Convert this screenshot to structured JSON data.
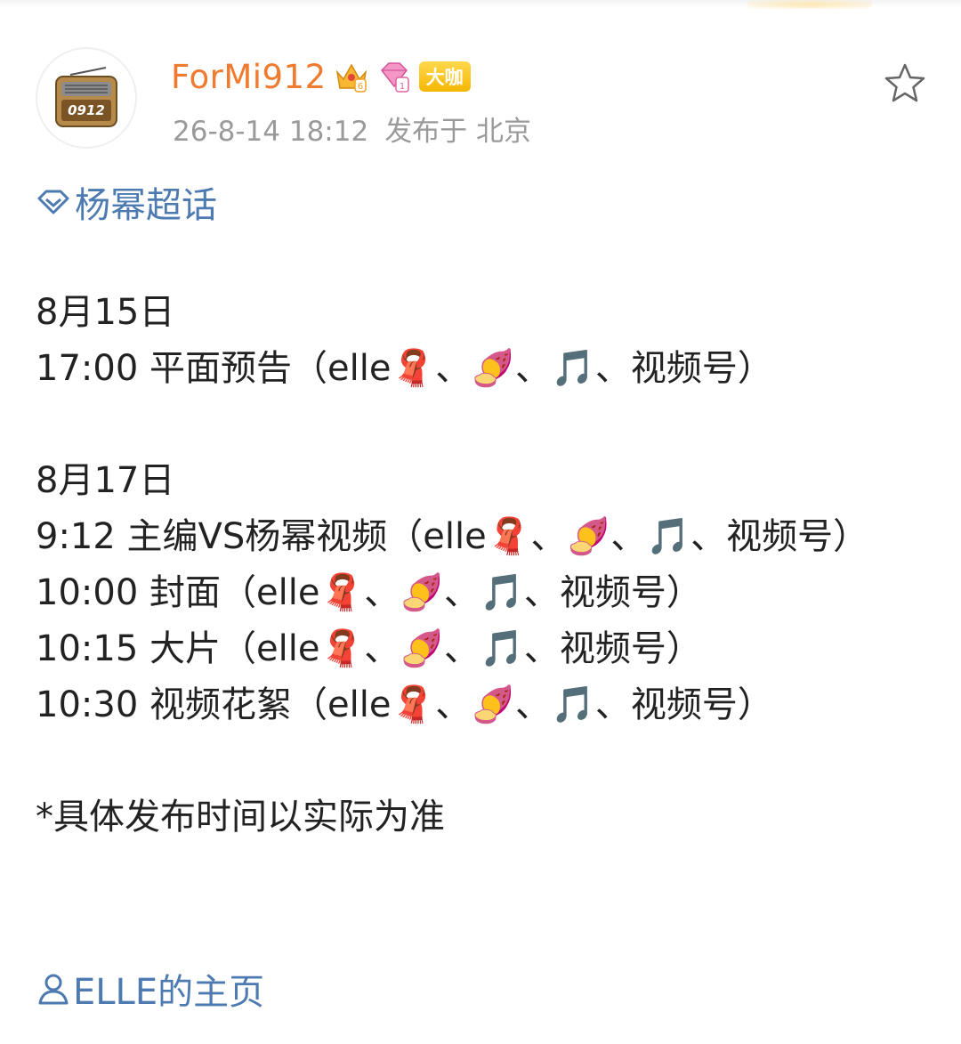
{
  "post": {
    "username": "ForMi912",
    "vip_tag": "大咖",
    "avatar_text": "0912",
    "timestamp": "26-8-14 18:12",
    "location": "发布于 北京",
    "topic": "杨幂超话",
    "footer_link": "ELLE的主页",
    "colors": {
      "username": "#f07a2e",
      "link": "#4d7bb1",
      "meta": "#9a9a9a",
      "vip_tag": "#f5b700"
    },
    "icons": [
      "avatar-radio",
      "crown-badge",
      "diamond-badge",
      "star-icon",
      "super-topic-icon",
      "user-icon",
      "scarf-emoji",
      "sweet-potato-emoji",
      "music-note-emoji"
    ]
  },
  "content": {
    "line1": "8月15日",
    "line2": "17:00 平面预告（elle🧣、🍠、🎵、视频号）",
    "line3": "8月17日",
    "line4": "9:12 主编VS杨幂视频（elle🧣、🍠、🎵、视频号）",
    "line5": "10:00 封面（elle🧣、🍠、🎵、视频号）",
    "line6": "10:15 大片（elle🧣、🍠、🎵、视频号）",
    "line7": "10:30 视频花絮（elle🧣、🍠、🎵、视频号）",
    "note": "*具体发布时间以实际为准"
  }
}
